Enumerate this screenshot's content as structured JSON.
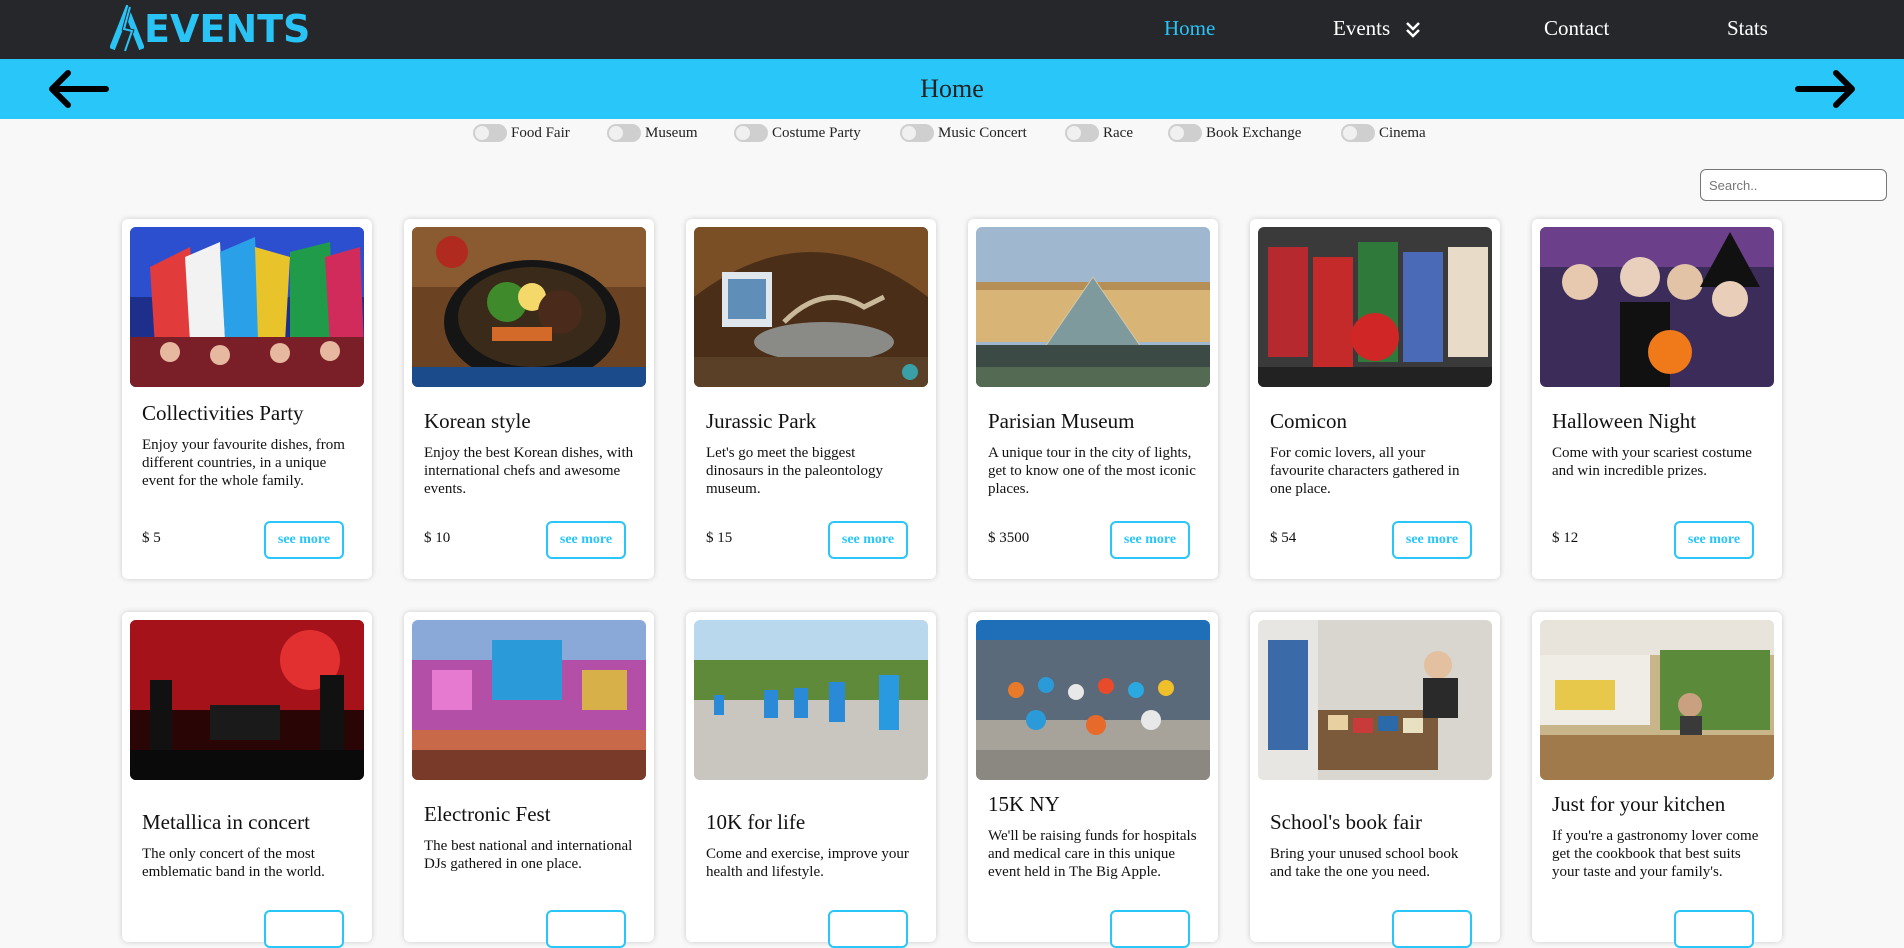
{
  "brand": {
    "logo_text": "EVENTS",
    "logo_letter": "A"
  },
  "nav": {
    "home": "Home",
    "events": "Events",
    "contact": "Contact",
    "stats": "Stats"
  },
  "banner": {
    "title": "Home"
  },
  "filters": [
    "Food Fair",
    "Museum",
    "Costume Party",
    "Music Concert",
    "Race",
    "Book Exchange",
    "Cinema"
  ],
  "search": {
    "placeholder": "Search.."
  },
  "colors": {
    "accent": "#29c6f9",
    "nav_bg": "#25272b",
    "page_bg": "#f8f8f8"
  },
  "cards": [
    {
      "title": "Collectivities Party",
      "desc": "Enjoy your favourite dishes, from different countries, in a unique event for the whole family.",
      "price": "$ 5",
      "button": "see more"
    },
    {
      "title": "Korean style",
      "desc": "Enjoy the best Korean dishes, with international chefs and awesome events.",
      "price": "$ 10",
      "button": "see more"
    },
    {
      "title": "Jurassic Park",
      "desc": "Let's go meet the biggest dinosaurs in the paleontology museum.",
      "price": "$ 15",
      "button": "see more"
    },
    {
      "title": "Parisian Museum",
      "desc": "A unique tour in the city of lights, get to know one of the most iconic places.",
      "price": "$ 3500",
      "button": "see more"
    },
    {
      "title": "Comicon",
      "desc": "For comic lovers, all your favourite characters gathered in one place.",
      "price": "$ 54",
      "button": "see more"
    },
    {
      "title": "Halloween Night",
      "desc": "Come with your scariest costume and win incredible prizes.",
      "price": "$ 12",
      "button": "see more"
    },
    {
      "title": "Metallica in concert",
      "desc": "The only concert of the most emblematic band in the world.",
      "price": "",
      "button": ""
    },
    {
      "title": "Electronic Fest",
      "desc": "The best national and international DJs gathered in one place.",
      "price": "",
      "button": ""
    },
    {
      "title": "10K for life",
      "desc": "Come and exercise, improve your health and lifestyle.",
      "price": "",
      "button": ""
    },
    {
      "title": "15K NY",
      "desc": "We'll be raising funds for hospitals and medical care in this unique event held in The Big Apple.",
      "price": "",
      "button": ""
    },
    {
      "title": "School's book fair",
      "desc": "Bring your unused school book and take the one you need.",
      "price": "",
      "button": ""
    },
    {
      "title": "Just for your kitchen",
      "desc": "If you're a gastronomy lover come get the cookbook that best suits your taste and your family's.",
      "price": "",
      "button": ""
    }
  ]
}
